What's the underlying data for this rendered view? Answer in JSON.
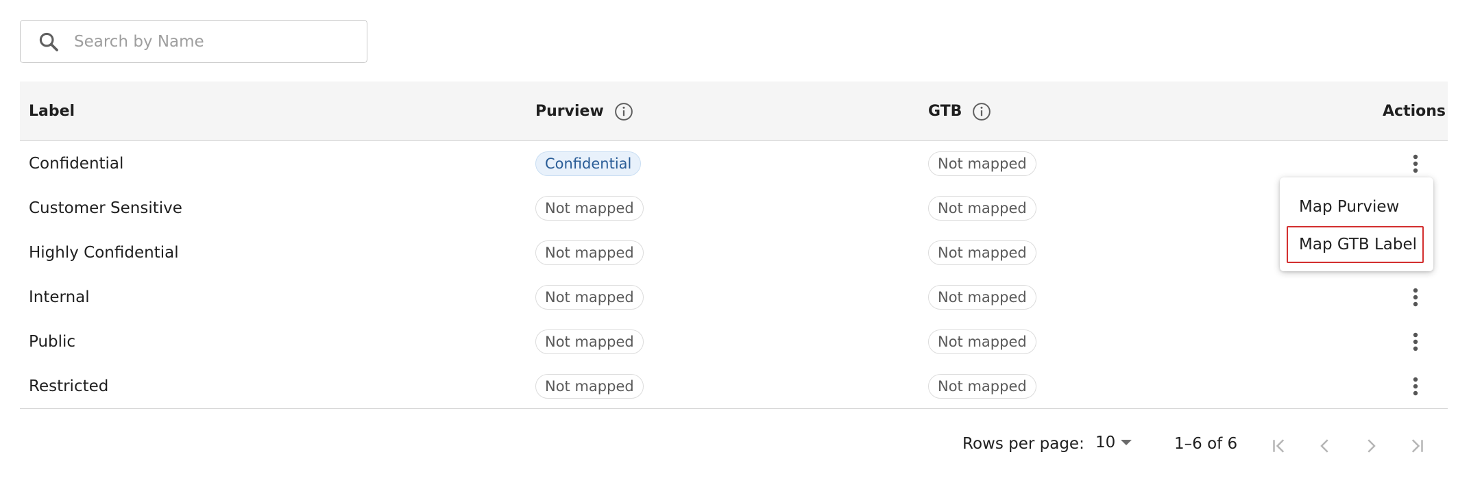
{
  "search": {
    "placeholder": "Search by Name",
    "value": ""
  },
  "table": {
    "headers": {
      "label": "Label",
      "purview": "Purview",
      "gtb": "GTB",
      "actions": "Actions"
    },
    "rows": [
      {
        "label": "Confidential",
        "purview": "Confidential",
        "purview_mapped": true,
        "gtb": "Not mapped"
      },
      {
        "label": "Customer Sensitive",
        "purview": "Not mapped",
        "purview_mapped": false,
        "gtb": "Not mapped"
      },
      {
        "label": "Highly Confidential",
        "purview": "Not mapped",
        "purview_mapped": false,
        "gtb": "Not mapped"
      },
      {
        "label": "Internal",
        "purview": "Not mapped",
        "purview_mapped": false,
        "gtb": "Not mapped"
      },
      {
        "label": "Public",
        "purview": "Not mapped",
        "purview_mapped": false,
        "gtb": "Not mapped"
      },
      {
        "label": "Restricted",
        "purview": "Not mapped",
        "purview_mapped": false,
        "gtb": "Not mapped"
      }
    ]
  },
  "menu": {
    "items": [
      "Map Purview",
      "Map GTB Label"
    ],
    "highlighted_item": "Map GTB Label"
  },
  "pagination": {
    "rows_per_page_label": "Rows per page:",
    "rows_per_page_value": "10",
    "range": "1–6 of 6"
  },
  "colors": {
    "mapped_chip_bg": "#e8f1fb",
    "mapped_chip_text": "#2a5d97",
    "highlight_border": "#d32f2f"
  }
}
